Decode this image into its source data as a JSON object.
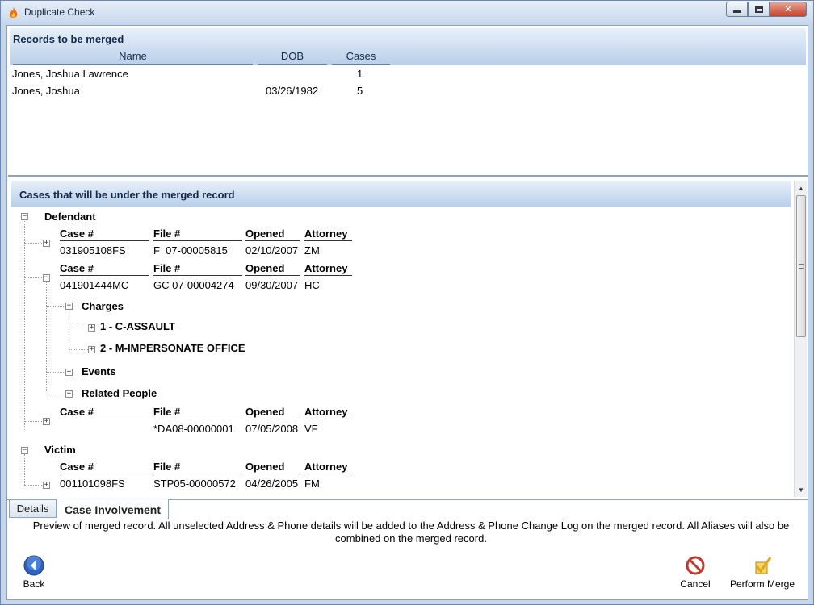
{
  "window": {
    "title": "Duplicate Check"
  },
  "records_panel": {
    "title": "Records to be merged",
    "columns": [
      "Name",
      "DOB",
      "Cases"
    ],
    "rows": [
      {
        "name": "Jones, Joshua Lawrence",
        "dob": "",
        "cases": "1"
      },
      {
        "name": "Jones, Joshua",
        "dob": "03/26/1982",
        "cases": "5"
      }
    ]
  },
  "cases_panel": {
    "title": "Cases that will be under the merged record",
    "columns": [
      "Case #",
      "File #",
      "Opened",
      "Attorney"
    ],
    "defendant": {
      "label": "Defendant",
      "cases": [
        {
          "case": "031905108FS",
          "file": "F  07-00005815",
          "opened": "02/10/2007",
          "attorney": "ZM"
        },
        {
          "case": "041901444MC",
          "file": "GC 07-00004274",
          "opened": "09/30/2007",
          "attorney": "HC"
        },
        {
          "case": "",
          "file": "*DA08-00000001",
          "opened": "07/05/2008",
          "attorney": "VF"
        }
      ],
      "charges_label": "Charges",
      "charges": [
        "1 - C-ASSAULT",
        "2 - M-IMPERSONATE OFFICE"
      ],
      "events_label": "Events",
      "related_label": "Related People"
    },
    "victim": {
      "label": "Victim",
      "cases": [
        {
          "case": "001101098FS",
          "file": "STP05-00000572",
          "opened": "04/26/2005",
          "attorney": "FM"
        }
      ]
    }
  },
  "tabs": [
    "Details",
    "Case Involvement"
  ],
  "preview_text": "Preview of merged record.  All unselected Address & Phone details will be added to the Address & Phone Change Log on the merged record. All Aliases will also be combined on the merged record.",
  "buttons": {
    "back": "Back",
    "cancel": "Cancel",
    "perform_merge": "Perform Merge"
  },
  "colors": {
    "accent": "#b9cfe9",
    "title_bar": "#c7d7ec",
    "back_button": "#2a63c4",
    "cancel_icon": "#c0392b",
    "merge_icon": "#e0a81a"
  }
}
